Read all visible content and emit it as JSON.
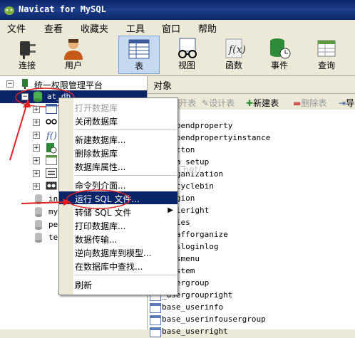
{
  "app": {
    "title": "Navicat for MySQL"
  },
  "menu": [
    "文件",
    "查看",
    "收藏夹",
    "工具",
    "窗口",
    "帮助"
  ],
  "toolbar": [
    {
      "label": "连接",
      "icon": "plug-icon"
    },
    {
      "label": "用户",
      "icon": "user-icon"
    },
    {
      "label": "表",
      "icon": "table-icon",
      "active": true
    },
    {
      "label": "视图",
      "icon": "glasses-icon"
    },
    {
      "label": "函数",
      "icon": "function-icon"
    },
    {
      "label": "事件",
      "icon": "event-icon"
    },
    {
      "label": "查询",
      "icon": "query-icon"
    }
  ],
  "tree": {
    "root": "统一权限管理平台",
    "selected_db": "at_db",
    "other_dbs": [
      "in",
      "my",
      "pe",
      "te"
    ]
  },
  "right": {
    "tab": "对象",
    "tools": [
      "开表",
      "设计表",
      "新建表",
      "删除表",
      "导"
    ],
    "tables": [
      "_appendproperty",
      "_appendpropertyinstance",
      "_button",
      "_o_a_setup",
      "_organization",
      "_recyclebin",
      "_region",
      "_roleright",
      "_roles",
      "_stafforganize",
      "_sysloginlog",
      "_sysmenu",
      "_system",
      "_usergroup",
      "_usergroupright",
      "base_userinfo",
      "base_userinfousergroup",
      "base_userright"
    ]
  },
  "context_menu": [
    {
      "label": "打开数据库",
      "disabled": true
    },
    {
      "label": "关闭数据库"
    },
    {
      "sep": true
    },
    {
      "label": "新建数据库..."
    },
    {
      "label": "删除数据库"
    },
    {
      "label": "数据库属性..."
    },
    {
      "sep": true
    },
    {
      "label": "命令列介面..."
    },
    {
      "label": "运行 SQL 文件...",
      "highlight": true
    },
    {
      "label": "转储 SQL 文件",
      "submenu": true
    },
    {
      "label": "打印数据库..."
    },
    {
      "label": "数据传输..."
    },
    {
      "label": "逆向数据库到模型..."
    },
    {
      "label": "在数据库中查找..."
    },
    {
      "sep": true
    },
    {
      "label": "刷新"
    }
  ],
  "watermark": "http://blog.csdn.net/",
  "colors": {
    "title": "#0a246a",
    "highlight": "#0a246a",
    "annotation": "#e02020"
  }
}
